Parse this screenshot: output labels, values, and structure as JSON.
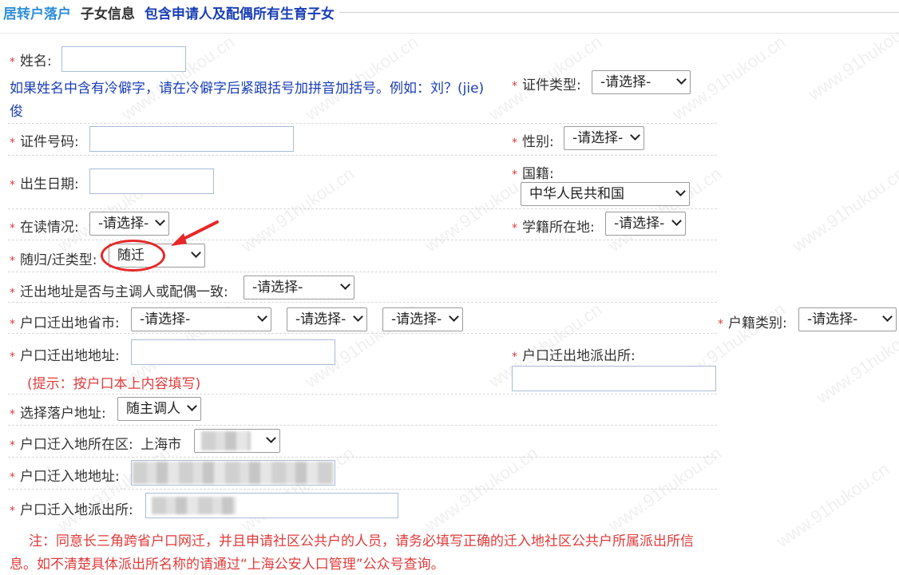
{
  "header": {
    "section": "居转户落户",
    "subtitle": "子女信息",
    "note": "包含申请人及配偶所有生育子女"
  },
  "fields": {
    "name": {
      "label": "姓名:",
      "value": ""
    },
    "name_hint": {
      "line1": "如果姓名中含有冷僻字，请在冷僻字后紧跟括号加拼音加括号。例如：刘？(jie)",
      "line2": "俊"
    },
    "id_type": {
      "label": "证件类型:",
      "value": "-请选择-"
    },
    "id_number": {
      "label": "证件号码:",
      "value": ""
    },
    "gender": {
      "label": "性别:",
      "value": "-请选择-"
    },
    "birth_date": {
      "label": "出生日期:",
      "value": ""
    },
    "nationality": {
      "label": "国籍:",
      "value": "中华人民共和国"
    },
    "study_status": {
      "label": "在读情况:",
      "value": "-请选择-"
    },
    "school_location": {
      "label": "学籍所在地:",
      "value": "-请选择-"
    },
    "move_type": {
      "label": "随归/迁类型:",
      "value": "随迁"
    },
    "same_address": {
      "label": "迁出地址是否与主调人或配偶一致:",
      "value": "-请选择-"
    },
    "out_province_city": {
      "label": "户口迁出地省市:",
      "select1": "-请选择-",
      "select2": "-请选择-",
      "select3": "-请选择-"
    },
    "hukou_type": {
      "label": "户籍类别:",
      "value": "-请选择-"
    },
    "out_address": {
      "label": "户口迁出地地址:",
      "value": ""
    },
    "out_address_hint": "(提示：按户口本上内容填写)",
    "out_police": {
      "label": "户口迁出地派出所:",
      "value": ""
    },
    "settle_address": {
      "label": "选择落户地址:",
      "value": "随主调人"
    },
    "in_district": {
      "label": "户口迁入地所在区:",
      "city": "上海市",
      "value": ""
    },
    "in_address": {
      "label": "户口迁入地地址:",
      "value": ""
    },
    "in_police": {
      "label": "户口迁入地派出所:",
      "value": ""
    }
  },
  "notice": {
    "line1": "注：同意长三角跨省户口网迁，并且申请社区公共户的人员，请务必填写正确的迁入地社区公共户所属派出所信",
    "line2": "息。如不清楚具体派出所名称的请通过“上海公安人口管理”公众号查询。"
  },
  "watermark": "www.91hukou.cn",
  "colors": {
    "required": "#e03b3b",
    "section_title": "#2f8fd8",
    "hint_blue": "#1a3fb5",
    "highlight": "#e62828"
  },
  "icons": {
    "dropdown": "chevron-down-icon",
    "annotation": "arrow-annotation-icon"
  }
}
